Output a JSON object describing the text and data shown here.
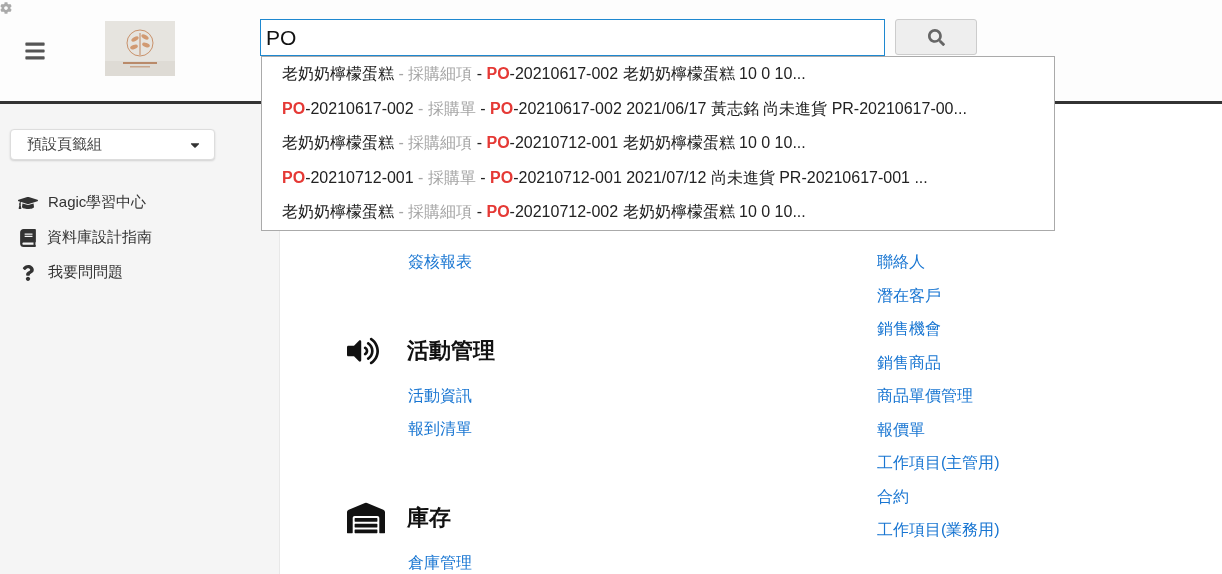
{
  "search": {
    "value": "PO"
  },
  "suggestions": [
    {
      "text": "老奶奶檸檬蛋糕 *- 採購細項* - **PO**-20210617-002 老奶奶檸檬蛋糕 10 0 10..."
    },
    {
      "text": "**PO**-20210617-002 *- 採購單* - **PO**-20210617-002 2021/06/17 黃志銘 尚未進貨 PR-20210617-00..."
    },
    {
      "text": "老奶奶檸檬蛋糕 *- 採購細項* - **PO**-20210712-001 老奶奶檸檬蛋糕 10 0 10..."
    },
    {
      "text": "**PO**-20210712-001 *- 採購單* - **PO**-20210712-001 2021/07/12 尚未進貨 PR-20210617-001 ..."
    },
    {
      "text": "老奶奶檸檬蛋糕 *- 採購細項* - **PO**-20210712-002 老奶奶檸檬蛋糕 10 0 10..."
    }
  ],
  "sidebar": {
    "tab_group": "預設頁籤組",
    "items": [
      {
        "kind": "course",
        "label": "Ragic學習中心"
      },
      {
        "kind": "guide",
        "label": "資料庫設計指南"
      },
      {
        "kind": "help",
        "label": "我要問問題"
      }
    ]
  },
  "left_column": {
    "links": [
      "簽核報表"
    ],
    "sections": [
      {
        "kind": "events",
        "title": "活動管理",
        "links": [
          "活動資訊",
          "報到清單"
        ]
      },
      {
        "kind": "inventory",
        "title": "庫存",
        "links": [
          "倉庫管理"
        ]
      }
    ]
  },
  "right_column": {
    "links": [
      "聯絡人",
      "潛在客戶",
      "銷售機會",
      "銷售商品",
      "商品單價管理",
      "報價單",
      "工作項目(主管用)",
      "合約",
      "工作項目(業務用)"
    ]
  }
}
